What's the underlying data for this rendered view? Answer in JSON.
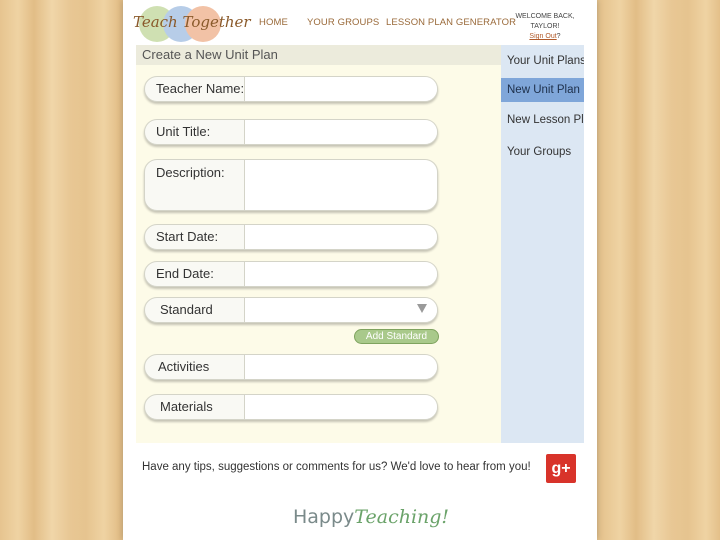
{
  "header": {
    "logo_text": "Teach Together",
    "nav": [
      "HOME",
      "YOUR GROUPS",
      "LESSON PLAN GENERATOR"
    ],
    "welcome": "WELCOME BACK, TAYLOR!",
    "sign_out": "Sign Out",
    "sign_out_suffix": "?"
  },
  "form": {
    "title": "Create a New Unit Plan",
    "fields": [
      {
        "label": "Teacher Name:",
        "value": ""
      },
      {
        "label": "Unit Title:",
        "value": ""
      },
      {
        "label": "Description:",
        "value": ""
      },
      {
        "label": "Start Date:",
        "value": ""
      },
      {
        "label": "End Date:",
        "value": ""
      },
      {
        "label": "Standard",
        "value": ""
      },
      {
        "label": "Activities",
        "value": ""
      },
      {
        "label": "Materials",
        "value": ""
      }
    ],
    "add_standard": "Add Standard"
  },
  "side_menu": {
    "items": [
      "Your Unit Plans",
      "New Unit Plan",
      "New Lesson Plan",
      "Your Groups"
    ],
    "active": "New Unit Plan"
  },
  "footer": {
    "tips": "Have any tips, suggestions or comments for us? We'd love to hear from you!",
    "gplus_icon": "g+",
    "brand_part1": "Happy",
    "brand_part2": "Teaching!"
  },
  "colors": {
    "accent_blue": "#7fa6d9",
    "side_bg": "#dce7f3",
    "panel_bg": "#fdfbe8",
    "button_green": "#a9c98b",
    "gplus_red": "#d8332a"
  }
}
